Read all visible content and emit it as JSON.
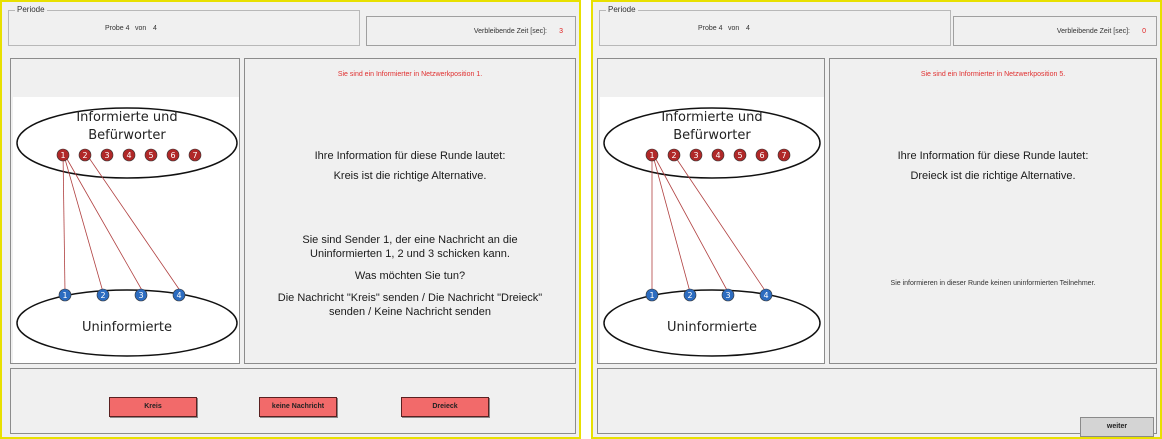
{
  "left": {
    "period_label": "Periode",
    "probe": "Probe 4",
    "von": "von",
    "total": "4",
    "time_label": "Verbleibende Zeit [sec]:",
    "time_value": "3",
    "network_position": "Sie sind ein Informierter in Netzwerkposition 1.",
    "diagram": {
      "top_label_line1": "Informierte und",
      "top_label_line2": "Befürworter",
      "bottom_label": "Uninformierte",
      "informed_nodes": [
        "1",
        "2",
        "3",
        "4",
        "5",
        "6",
        "7"
      ],
      "uninformed_nodes": [
        "1",
        "2",
        "3",
        "4"
      ]
    },
    "info_heading": "Ihre Information für diese Runde lautet:",
    "info_value": "Kreis ist die richtige Alternative.",
    "sender_line1": "Sie sind Sender 1, der eine Nachricht an die",
    "sender_line2": "Uninformierten 1, 2 und 3 schicken kann.",
    "question": "Was möchten Sie tun?",
    "options_line1": "Die Nachricht \"Kreis\" senden / Die Nachricht \"Dreieck\"",
    "options_line2": "senden / Keine Nachricht senden",
    "buttons": {
      "kreis": "Kreis",
      "keine": "keine Nachricht",
      "dreieck": "Dreieck"
    },
    "colors": {
      "button": "#f26a6a",
      "accent": "#e02020",
      "frame": "#e8e000"
    }
  },
  "right": {
    "period_label": "Periode",
    "probe": "Probe 4",
    "von": "von",
    "total": "4",
    "time_label": "Verbleibende Zeit [sec]:",
    "time_value": "0",
    "network_position": "Sie sind ein Informierter in Netzwerkposition 5.",
    "diagram": {
      "top_label_line1": "Informierte und",
      "top_label_line2": "Befürworter",
      "bottom_label": "Uninformierte",
      "informed_nodes": [
        "1",
        "2",
        "3",
        "4",
        "5",
        "6",
        "7"
      ],
      "uninformed_nodes": [
        "1",
        "2",
        "3",
        "4"
      ]
    },
    "info_heading": "Ihre Information für diese Runde lautet:",
    "info_value": "Dreieck ist die richtige Alternative.",
    "no_send_msg": "Sie informieren in dieser Runde keinen uninformierten Teilnehmer.",
    "next_button": "weiter"
  }
}
